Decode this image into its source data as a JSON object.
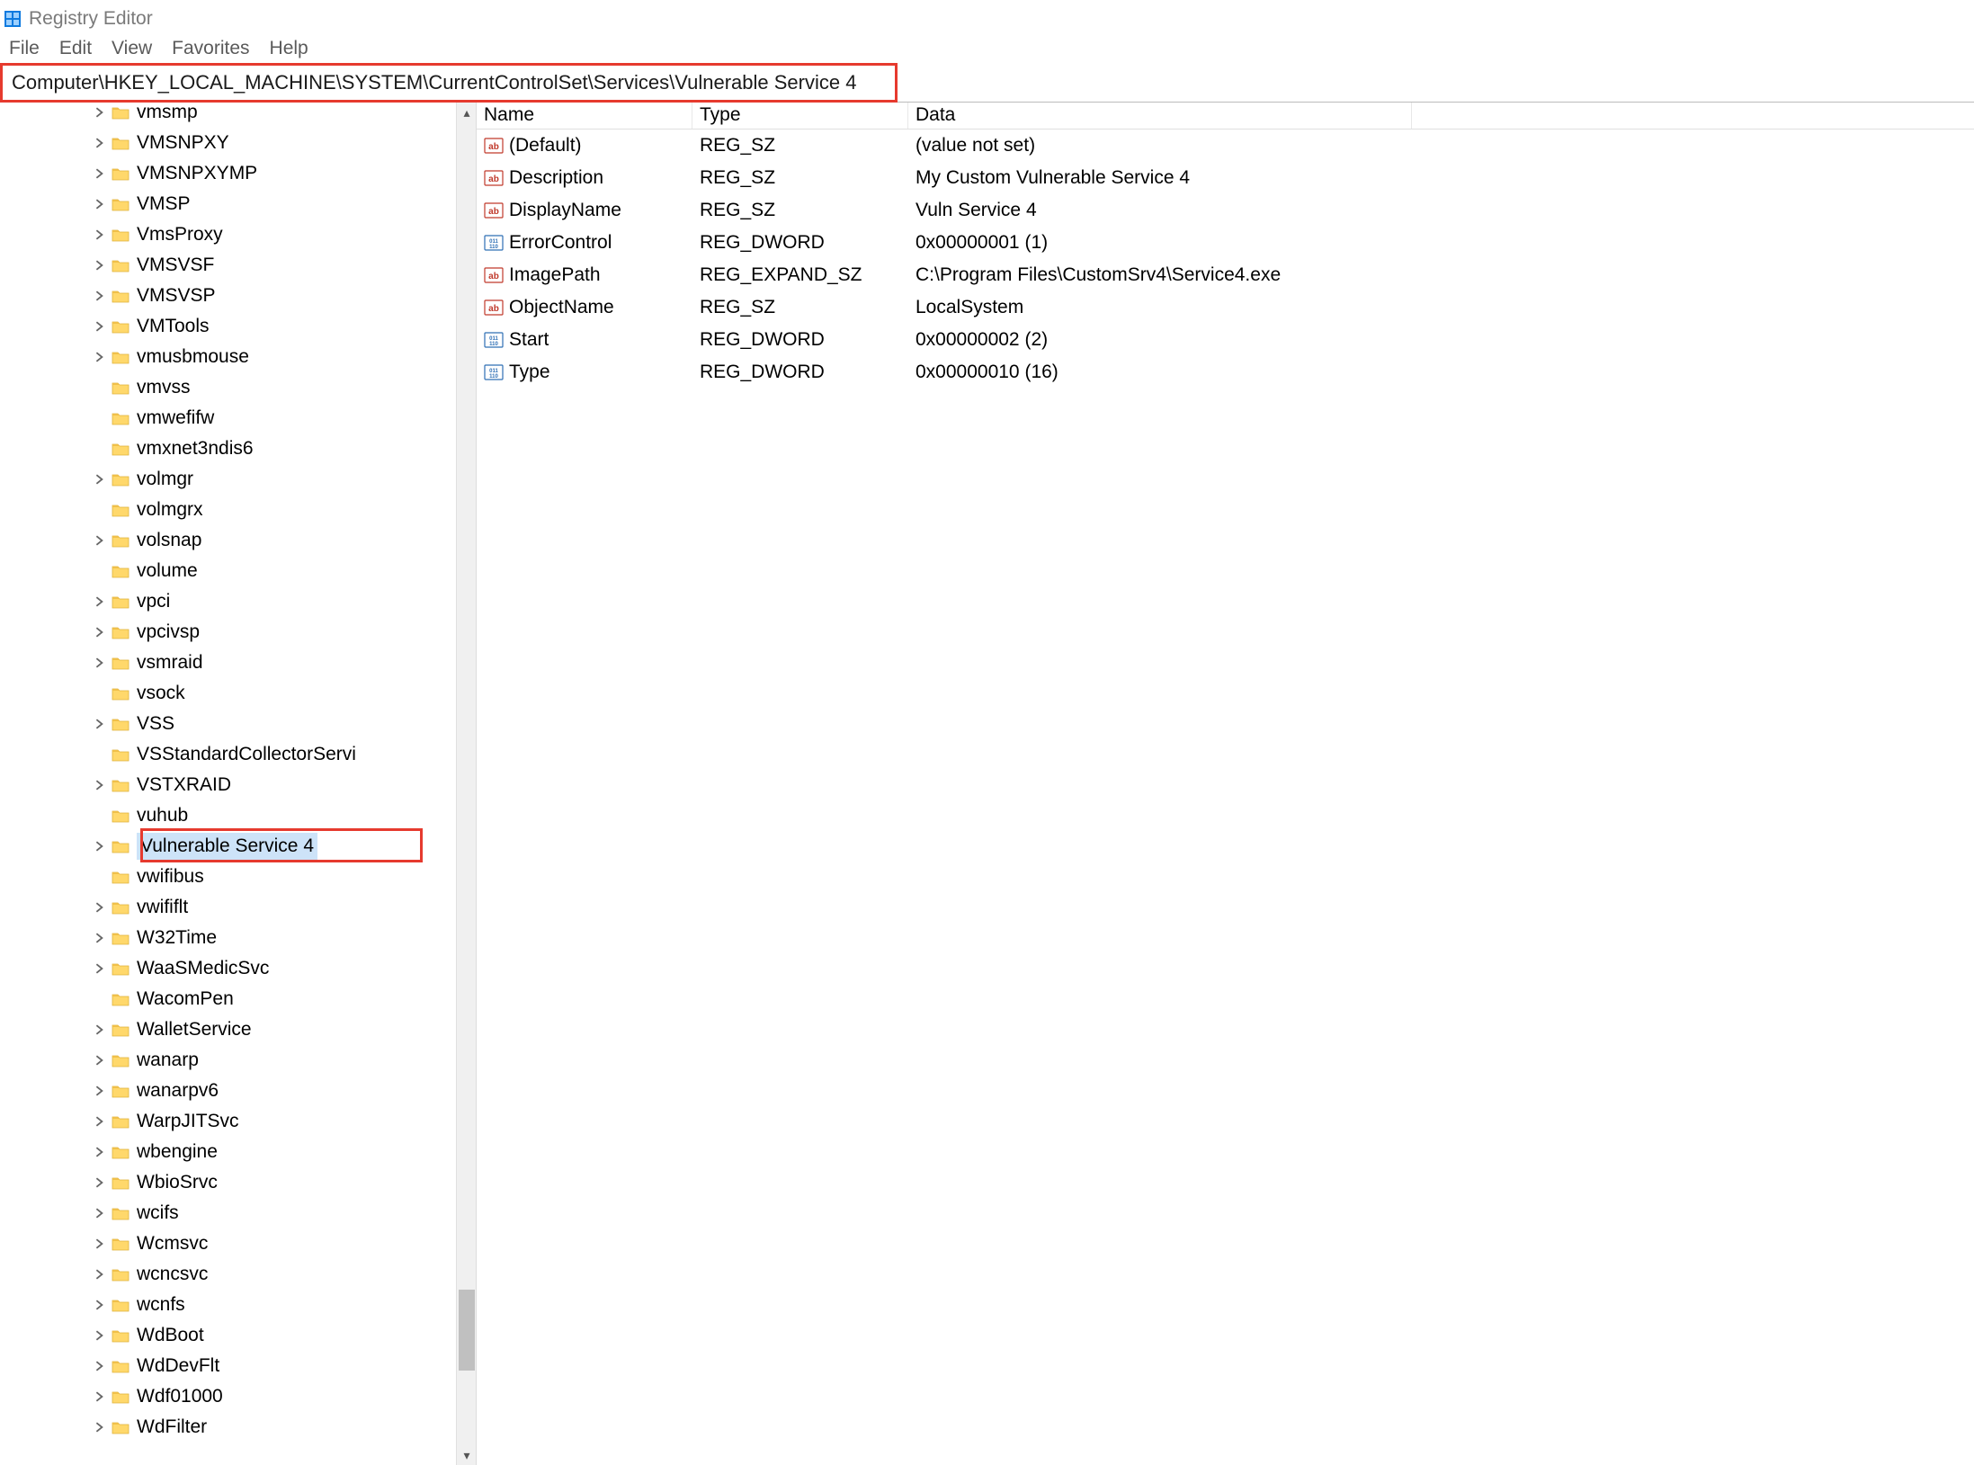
{
  "title": "Registry Editor",
  "menubar": [
    "File",
    "Edit",
    "View",
    "Favorites",
    "Help"
  ],
  "address": "Computer\\HKEY_LOCAL_MACHINE\\SYSTEM\\CurrentControlSet\\Services\\Vulnerable Service 4",
  "tree": [
    {
      "label": "vmsmp",
      "exp": true
    },
    {
      "label": "VMSNPXY",
      "exp": true
    },
    {
      "label": "VMSNPXYMP",
      "exp": true
    },
    {
      "label": "VMSP",
      "exp": true
    },
    {
      "label": "VmsProxy",
      "exp": true
    },
    {
      "label": "VMSVSF",
      "exp": true
    },
    {
      "label": "VMSVSP",
      "exp": true
    },
    {
      "label": "VMTools",
      "exp": true
    },
    {
      "label": "vmusbmouse",
      "exp": true
    },
    {
      "label": "vmvss",
      "exp": false
    },
    {
      "label": "vmwefifw",
      "exp": false
    },
    {
      "label": "vmxnet3ndis6",
      "exp": false
    },
    {
      "label": "volmgr",
      "exp": true
    },
    {
      "label": "volmgrx",
      "exp": false
    },
    {
      "label": "volsnap",
      "exp": true
    },
    {
      "label": "volume",
      "exp": false
    },
    {
      "label": "vpci",
      "exp": true
    },
    {
      "label": "vpcivsp",
      "exp": true
    },
    {
      "label": "vsmraid",
      "exp": true
    },
    {
      "label": "vsock",
      "exp": false
    },
    {
      "label": "VSS",
      "exp": true
    },
    {
      "label": "VSStandardCollectorServi",
      "exp": false
    },
    {
      "label": "VSTXRAID",
      "exp": true
    },
    {
      "label": "vuhub",
      "exp": false
    },
    {
      "label": "Vulnerable Service 4",
      "exp": true,
      "selected": true
    },
    {
      "label": "vwifibus",
      "exp": false
    },
    {
      "label": "vwififlt",
      "exp": true
    },
    {
      "label": "W32Time",
      "exp": true
    },
    {
      "label": "WaaSMedicSvc",
      "exp": true
    },
    {
      "label": "WacomPen",
      "exp": false
    },
    {
      "label": "WalletService",
      "exp": true
    },
    {
      "label": "wanarp",
      "exp": true
    },
    {
      "label": "wanarpv6",
      "exp": true
    },
    {
      "label": "WarpJITSvc",
      "exp": true
    },
    {
      "label": "wbengine",
      "exp": true
    },
    {
      "label": "WbioSrvc",
      "exp": true
    },
    {
      "label": "wcifs",
      "exp": true
    },
    {
      "label": "Wcmsvc",
      "exp": true
    },
    {
      "label": "wcncsvc",
      "exp": true
    },
    {
      "label": "wcnfs",
      "exp": true
    },
    {
      "label": "WdBoot",
      "exp": true
    },
    {
      "label": "WdDevFlt",
      "exp": true
    },
    {
      "label": "Wdf01000",
      "exp": true
    },
    {
      "label": "WdFilter",
      "exp": true
    }
  ],
  "columns": {
    "name": "Name",
    "type": "Type",
    "data": "Data"
  },
  "values": [
    {
      "icon": "str",
      "name": "(Default)",
      "type": "REG_SZ",
      "data": "(value not set)"
    },
    {
      "icon": "str",
      "name": "Description",
      "type": "REG_SZ",
      "data": "My Custom Vulnerable Service 4"
    },
    {
      "icon": "str",
      "name": "DisplayName",
      "type": "REG_SZ",
      "data": "Vuln Service 4"
    },
    {
      "icon": "bin",
      "name": "ErrorControl",
      "type": "REG_DWORD",
      "data": "0x00000001 (1)"
    },
    {
      "icon": "str",
      "name": "ImagePath",
      "type": "REG_EXPAND_SZ",
      "data": "C:\\Program Files\\CustomSrv4\\Service4.exe"
    },
    {
      "icon": "str",
      "name": "ObjectName",
      "type": "REG_SZ",
      "data": "LocalSystem"
    },
    {
      "icon": "bin",
      "name": "Start",
      "type": "REG_DWORD",
      "data": "0x00000002 (2)"
    },
    {
      "icon": "bin",
      "name": "Type",
      "type": "REG_DWORD",
      "data": "0x00000010 (16)"
    }
  ]
}
